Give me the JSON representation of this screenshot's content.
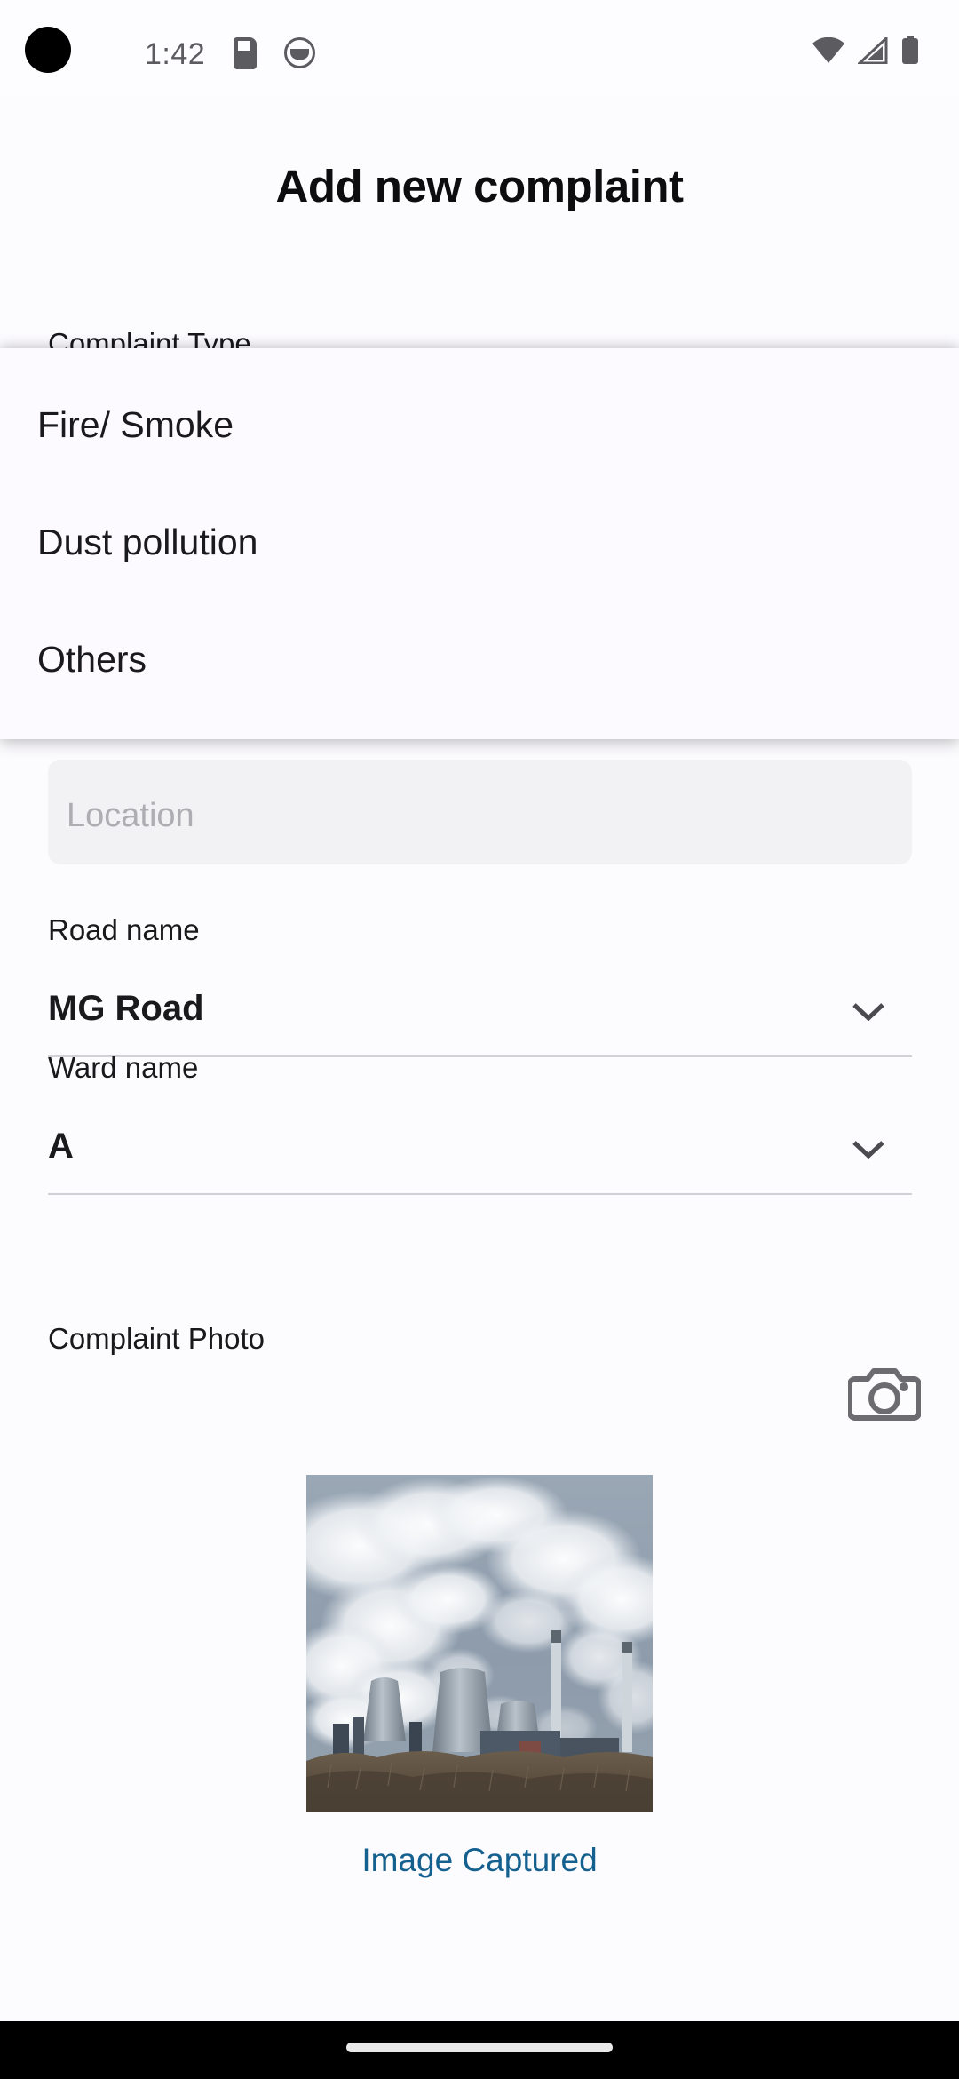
{
  "status_bar": {
    "time": "1:42",
    "icons": [
      "sd-card-icon",
      "app-notification-icon",
      "wifi-icon",
      "cellular-signal-icon",
      "battery-icon"
    ]
  },
  "header": {
    "title": "Add new complaint"
  },
  "form": {
    "complaint_type": {
      "label": "Complaint Type",
      "options": [
        "Fire/ Smoke",
        "Dust pollution",
        "Others"
      ]
    },
    "location": {
      "label": "Location",
      "placeholder": "Location",
      "value": ""
    },
    "road_name": {
      "label": "Road name",
      "value": "MG Road"
    },
    "ward_name": {
      "label": "Ward name",
      "value": "A"
    },
    "complaint_photo": {
      "label": "Complaint Photo",
      "camera_button": "camera-icon",
      "status_text": "Image Captured"
    }
  },
  "colors": {
    "background": "#fcfbfe",
    "text_primary": "#1a1a1e",
    "placeholder": "#adadb2",
    "link_blue": "#14608f",
    "icon_gray": "#6b6b70",
    "nav_bar": "#000000"
  }
}
